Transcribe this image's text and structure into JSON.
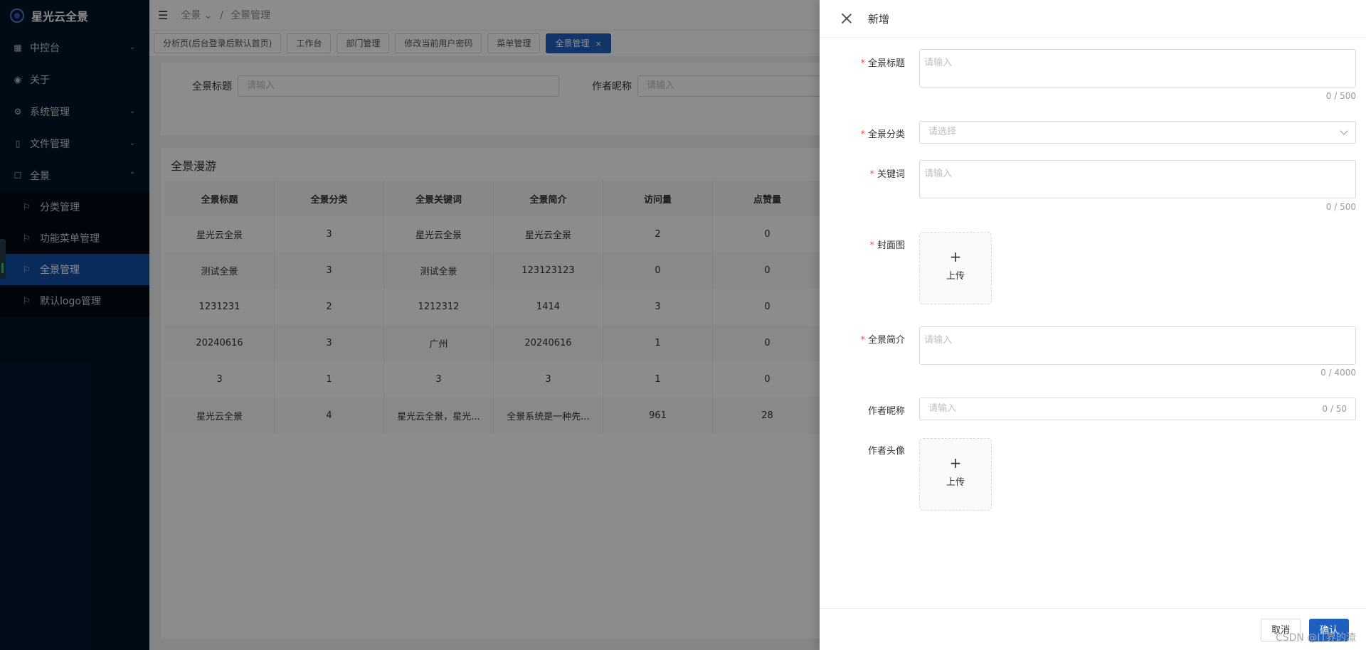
{
  "app": {
    "title": "星光云全景"
  },
  "sidebar": {
    "items": [
      {
        "label": "中控台",
        "icon": "dashboard-icon"
      },
      {
        "label": "关于",
        "icon": "eye-icon"
      },
      {
        "label": "系统管理",
        "icon": "gear-icon"
      },
      {
        "label": "文件管理",
        "icon": "file-icon"
      },
      {
        "label": "全景",
        "icon": "square-icon"
      }
    ],
    "submenu": [
      {
        "label": "分类管理"
      },
      {
        "label": "功能菜单管理"
      },
      {
        "label": "全景管理"
      },
      {
        "label": "默认logo管理"
      }
    ]
  },
  "breadcrumb": {
    "root": "全景",
    "current": "全景管理"
  },
  "tabs": [
    {
      "label": "分析页(后台登录后默认首页)"
    },
    {
      "label": "工作台"
    },
    {
      "label": "部门管理"
    },
    {
      "label": "修改当前用户密码"
    },
    {
      "label": "菜单管理"
    },
    {
      "label": "全景管理"
    }
  ],
  "search": {
    "title_label": "全景标题",
    "title_placeholder": "请输入",
    "author_label": "作者昵称",
    "author_placeholder": "请输入"
  },
  "table": {
    "title": "全景漫游",
    "columns": [
      "全景标题",
      "全景分类",
      "全景关键词",
      "全景简介",
      "访问量",
      "点赞量"
    ],
    "rows": [
      [
        "星光云全景",
        "3",
        "星光云全景",
        "星光云全景",
        "2",
        "0"
      ],
      [
        "测试全景",
        "3",
        "测试全景",
        "123123123",
        "0",
        "0"
      ],
      [
        "1231231",
        "2",
        "1212312",
        "1414",
        "3",
        "0"
      ],
      [
        "20240616",
        "3",
        "广州",
        "20240616",
        "1",
        "0"
      ],
      [
        "3",
        "1",
        "3",
        "3",
        "1",
        "0"
      ],
      [
        "星光云全景",
        "4",
        "星光云全景，星光...",
        "全景系统是一种先...",
        "961",
        "28"
      ]
    ]
  },
  "drawer": {
    "title": "新增",
    "fields": {
      "title": {
        "label": "全景标题",
        "placeholder": "请输入",
        "count": "0 / 500"
      },
      "category": {
        "label": "全景分类",
        "placeholder": "请选择"
      },
      "keywords": {
        "label": "关键词",
        "placeholder": "请输入",
        "count": "0 / 500"
      },
      "cover": {
        "label": "封面图",
        "upload": "上传"
      },
      "intro": {
        "label": "全景简介",
        "placeholder": "请输入",
        "count": "0 / 4000"
      },
      "nickname": {
        "label": "作者昵称",
        "placeholder": "请输入",
        "count": "0 / 50"
      },
      "avatar": {
        "label": "作者头像",
        "upload": "上传"
      }
    },
    "cancel": "取消",
    "ok": "确认"
  },
  "watermark": "CSDN @IT界的渣",
  "colors": {
    "sidebar": "#001529",
    "primary": "#1f5fbf",
    "required": "#ff4d4f"
  }
}
